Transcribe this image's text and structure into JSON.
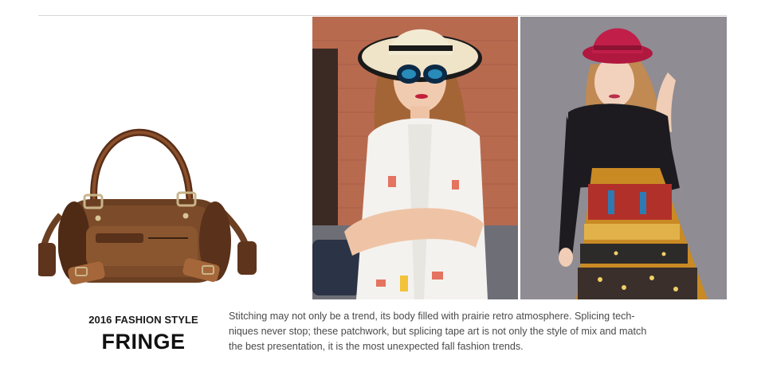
{
  "caption": {
    "subtitle": "2016 FASHION STYLE",
    "title": "FRINGE"
  },
  "description": {
    "lines": [
      "Stitching may not only be a trend, its body filled with prairie retro atmosphere. Splicing tech-",
      "niques never stop; these patchwork, but splicing tape art is not only the style of mix and match",
      "the best presentation, it is the most unexpected fall fashion trends."
    ]
  },
  "images": {
    "product": "brown-leather-barrel-handbag",
    "model_left": "woman-in-white-hat-and-sunglasses",
    "model_right": "woman-in-red-hat-and-patterned-dress"
  },
  "colors": {
    "leather": "#6b3f22",
    "hat_red": "#c21e4a",
    "brick": "#b86a4f",
    "studio_gray": "#8f8c93"
  }
}
